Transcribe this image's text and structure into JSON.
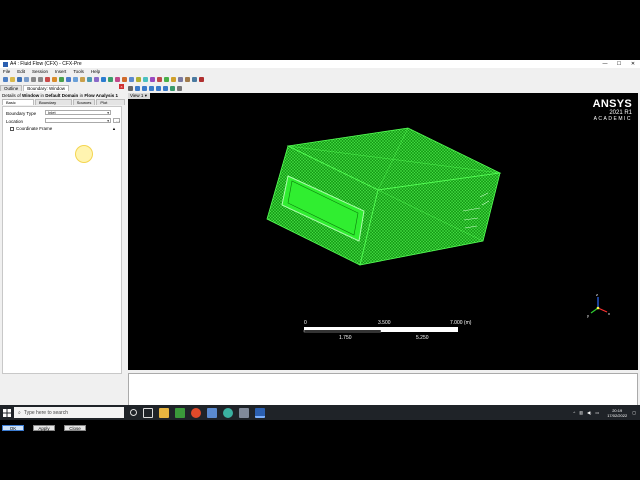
{
  "window": {
    "title": "A4 : Fluid Flow (CFX) - CFX-Pre",
    "controls": [
      "—",
      "☐",
      "✕"
    ]
  },
  "menu": [
    "File",
    "Edit",
    "Session",
    "Insert",
    "Tools",
    "Help"
  ],
  "left_panel": {
    "tabs": [
      "Outline",
      "Boundary: Window"
    ],
    "details_prefix": "Details of",
    "details_strong": "Window",
    "details_mid": "in",
    "details_domain": "Default Domain",
    "details_in": "in",
    "details_analysis": "Flow Analysis 1",
    "subtabs": [
      "Basic Settings",
      "Boundary Details",
      "Sources",
      "Plot Options"
    ],
    "boundary_type_label": "Boundary Type",
    "boundary_type_value": "Inlet",
    "location_label": "Location",
    "location_value": "",
    "coord_frame_label": "Coordinate Frame",
    "buttons": {
      "ok": "OK",
      "apply": "Apply",
      "close": "Close"
    }
  },
  "viewport": {
    "tab_label": "View 1",
    "brand": {
      "name": "ANSYS",
      "version": "2021 R1",
      "edition": "ACADEMIC"
    },
    "scale": {
      "top_labels": [
        "0",
        "3.500",
        "7.000  (m)"
      ],
      "bottom_labels": [
        "1.750",
        "5.250"
      ]
    },
    "colors": {
      "mesh": "#33dd33",
      "mesh_fill": "#1fae1f",
      "background": "#000000"
    }
  },
  "taskbar": {
    "search_placeholder": "Type here to search",
    "time": "20:19",
    "date": "17/02/2022"
  }
}
